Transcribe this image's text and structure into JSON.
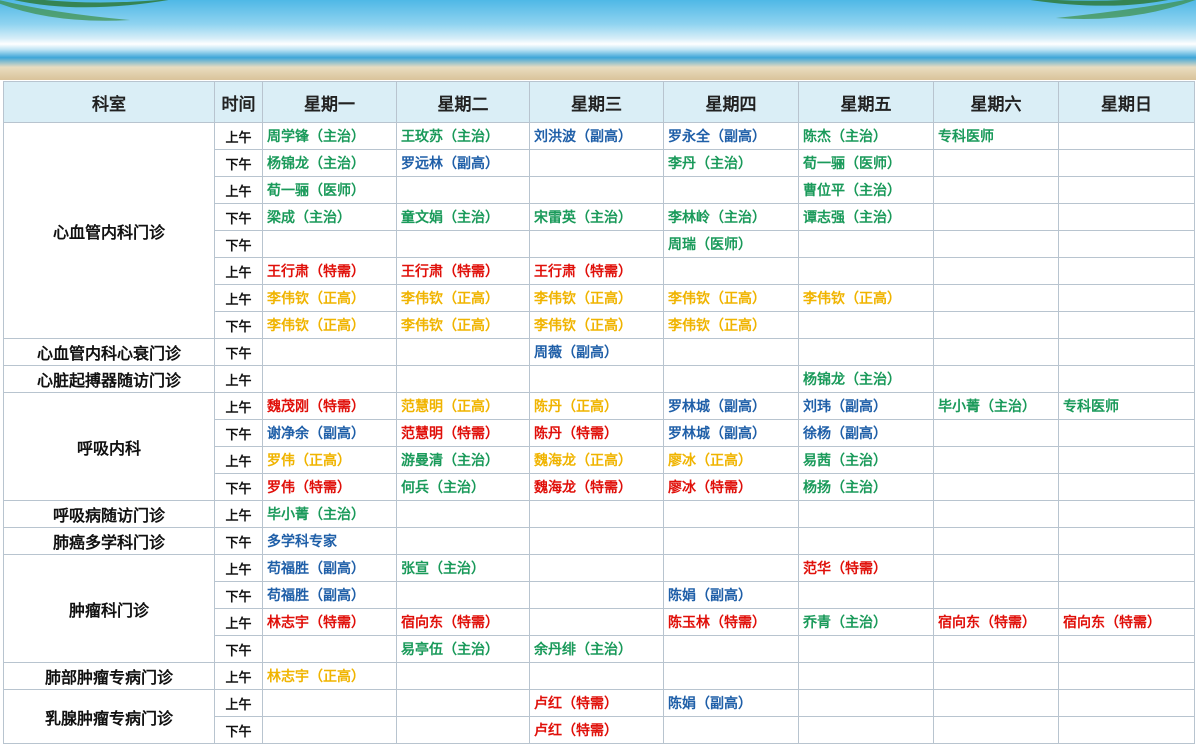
{
  "colors": {
    "blue": "#1f5fa8",
    "green": "#1a9a5a",
    "red": "#e0100a",
    "orange": "#f0b400",
    "header_bg": "#daeef6"
  },
  "headers": [
    "科室",
    "时间",
    "星期一",
    "星期二",
    "星期三",
    "星期四",
    "星期五",
    "星期六",
    "星期日"
  ],
  "rows": [
    {
      "dept": "心血管内科门诊",
      "span": 8,
      "time": "上午",
      "cells": [
        [
          "周学锋（主治）",
          "green"
        ],
        [
          "王玫苏（主治）",
          "green"
        ],
        [
          "刘洪波（副高）",
          "blue"
        ],
        [
          "罗永全（副高）",
          "blue"
        ],
        [
          "陈杰（主治）",
          "green"
        ],
        [
          "专科医师",
          "green"
        ],
        [
          "",
          ""
        ]
      ]
    },
    {
      "time": "下午",
      "cells": [
        [
          "杨锦龙（主治）",
          "green"
        ],
        [
          "罗远林（副高）",
          "blue"
        ],
        [
          "",
          ""
        ],
        [
          "李丹（主治）",
          "green"
        ],
        [
          "荀一骊（医师）",
          "green"
        ],
        [
          "",
          ""
        ],
        [
          "",
          ""
        ]
      ]
    },
    {
      "time": "上午",
      "cells": [
        [
          "荀一骊（医师）",
          "green"
        ],
        [
          "",
          ""
        ],
        [
          "",
          ""
        ],
        [
          "",
          ""
        ],
        [
          "曹位平（主治）",
          "green"
        ],
        [
          "",
          ""
        ],
        [
          "",
          ""
        ]
      ]
    },
    {
      "time": "下午",
      "cells": [
        [
          "梁成（主治）",
          "green"
        ],
        [
          "童文娟（主治）",
          "green"
        ],
        [
          "宋雷英（主治）",
          "green"
        ],
        [
          "李林岭（主治）",
          "green"
        ],
        [
          "谭志强（主治）",
          "green"
        ],
        [
          "",
          ""
        ],
        [
          "",
          ""
        ]
      ]
    },
    {
      "time": "下午",
      "cells": [
        [
          "",
          ""
        ],
        [
          "",
          ""
        ],
        [
          "",
          ""
        ],
        [
          "周瑞（医师）",
          "green"
        ],
        [
          "",
          ""
        ],
        [
          "",
          ""
        ],
        [
          "",
          ""
        ]
      ]
    },
    {
      "time": "上午",
      "cells": [
        [
          "王行肃（特需）",
          "red"
        ],
        [
          "王行肃（特需）",
          "red"
        ],
        [
          "王行肃（特需）",
          "red"
        ],
        [
          "",
          ""
        ],
        [
          "",
          ""
        ],
        [
          "",
          ""
        ],
        [
          "",
          ""
        ]
      ]
    },
    {
      "time": "上午",
      "cells": [
        [
          "李伟钦（正高）",
          "orange"
        ],
        [
          "李伟钦（正高）",
          "orange"
        ],
        [
          "李伟钦（正高）",
          "orange"
        ],
        [
          "李伟钦（正高）",
          "orange"
        ],
        [
          "李伟钦（正高）",
          "orange"
        ],
        [
          "",
          ""
        ],
        [
          "",
          ""
        ]
      ]
    },
    {
      "time": "下午",
      "cells": [
        [
          "李伟钦（正高）",
          "orange"
        ],
        [
          "李伟钦（正高）",
          "orange"
        ],
        [
          "李伟钦（正高）",
          "orange"
        ],
        [
          "李伟钦（正高）",
          "orange"
        ],
        [
          "",
          ""
        ],
        [
          "",
          ""
        ],
        [
          "",
          ""
        ]
      ]
    },
    {
      "dept": "心血管内科心衰门诊",
      "span": 1,
      "time": "下午",
      "cells": [
        [
          "",
          ""
        ],
        [
          "",
          ""
        ],
        [
          "周薇（副高）",
          "blue"
        ],
        [
          "",
          ""
        ],
        [
          "",
          ""
        ],
        [
          "",
          ""
        ],
        [
          "",
          ""
        ]
      ]
    },
    {
      "dept": "心脏起搏器随访门诊",
      "span": 1,
      "time": "上午",
      "cells": [
        [
          "",
          ""
        ],
        [
          "",
          ""
        ],
        [
          "",
          ""
        ],
        [
          "",
          ""
        ],
        [
          "杨锦龙（主治）",
          "green"
        ],
        [
          "",
          ""
        ],
        [
          "",
          ""
        ]
      ]
    },
    {
      "dept": "呼吸内科",
      "span": 4,
      "time": "上午",
      "cells": [
        [
          "魏茂刚（特需）",
          "red"
        ],
        [
          "范慧明（正高）",
          "orange"
        ],
        [
          "陈丹（正高）",
          "orange"
        ],
        [
          "罗林城（副高）",
          "blue"
        ],
        [
          "刘玮（副高）",
          "blue"
        ],
        [
          "毕小菁（主治）",
          "green"
        ],
        [
          "专科医师",
          "green"
        ]
      ]
    },
    {
      "time": "下午",
      "cells": [
        [
          "谢净余（副高）",
          "blue"
        ],
        [
          "范慧明（特需）",
          "red"
        ],
        [
          "陈丹（特需）",
          "red"
        ],
        [
          "罗林城（副高）",
          "blue"
        ],
        [
          "徐杨（副高）",
          "blue"
        ],
        [
          "",
          ""
        ],
        [
          "",
          ""
        ]
      ]
    },
    {
      "time": "上午",
      "cells": [
        [
          "罗伟（正高）",
          "orange"
        ],
        [
          "游曼清（主治）",
          "green"
        ],
        [
          "魏海龙（正高）",
          "orange"
        ],
        [
          "廖冰（正高）",
          "orange"
        ],
        [
          "易茜（主治）",
          "green"
        ],
        [
          "",
          ""
        ],
        [
          "",
          ""
        ]
      ]
    },
    {
      "time": "下午",
      "cells": [
        [
          "罗伟（特需）",
          "red"
        ],
        [
          "何兵（主治）",
          "green"
        ],
        [
          "魏海龙（特需）",
          "red"
        ],
        [
          "廖冰（特需）",
          "red"
        ],
        [
          "杨扬（主治）",
          "green"
        ],
        [
          "",
          ""
        ],
        [
          "",
          ""
        ]
      ]
    },
    {
      "dept": "呼吸病随访门诊",
      "span": 1,
      "time": "上午",
      "cells": [
        [
          "毕小菁（主治）",
          "green"
        ],
        [
          "",
          ""
        ],
        [
          "",
          ""
        ],
        [
          "",
          ""
        ],
        [
          "",
          ""
        ],
        [
          "",
          ""
        ],
        [
          "",
          ""
        ]
      ]
    },
    {
      "dept": "肺癌多学科门诊",
      "span": 1,
      "time": "下午",
      "cells": [
        [
          "多学科专家",
          "blue"
        ],
        [
          "",
          ""
        ],
        [
          "",
          ""
        ],
        [
          "",
          ""
        ],
        [
          "",
          ""
        ],
        [
          "",
          ""
        ],
        [
          "",
          ""
        ]
      ]
    },
    {
      "dept": "肿瘤科门诊",
      "span": 4,
      "time": "上午",
      "cells": [
        [
          "苟福胜（副高）",
          "blue"
        ],
        [
          "张宣（主治）",
          "green"
        ],
        [
          "",
          ""
        ],
        [
          "",
          ""
        ],
        [
          "范华（特需）",
          "red"
        ],
        [
          "",
          ""
        ],
        [
          "",
          ""
        ]
      ]
    },
    {
      "time": "下午",
      "cells": [
        [
          "苟福胜（副高）",
          "blue"
        ],
        [
          "",
          ""
        ],
        [
          "",
          ""
        ],
        [
          "陈娟（副高）",
          "blue"
        ],
        [
          "",
          ""
        ],
        [
          "",
          ""
        ],
        [
          "",
          ""
        ]
      ]
    },
    {
      "time": "上午",
      "cells": [
        [
          "林志宇（特需）",
          "red"
        ],
        [
          "宿向东（特需）",
          "red"
        ],
        [
          "",
          ""
        ],
        [
          "陈玉林（特需）",
          "red"
        ],
        [
          "乔青（主治）",
          "green"
        ],
        [
          "宿向东（特需）",
          "red"
        ],
        [
          "宿向东（特需）",
          "red"
        ]
      ]
    },
    {
      "time": "下午",
      "cells": [
        [
          "",
          ""
        ],
        [
          "易亭伍（主治）",
          "green"
        ],
        [
          "余丹绯（主治）",
          "green"
        ],
        [
          "",
          ""
        ],
        [
          "",
          ""
        ],
        [
          "",
          ""
        ],
        [
          "",
          ""
        ]
      ]
    },
    {
      "dept": "肺部肿瘤专病门诊",
      "span": 1,
      "time": "上午",
      "cells": [
        [
          "林志宇（正高）",
          "orange"
        ],
        [
          "",
          ""
        ],
        [
          "",
          ""
        ],
        [
          "",
          ""
        ],
        [
          "",
          ""
        ],
        [
          "",
          ""
        ],
        [
          "",
          ""
        ]
      ]
    },
    {
      "dept": "乳腺肿瘤专病门诊",
      "span": 2,
      "time": "上午",
      "cells": [
        [
          "",
          ""
        ],
        [
          "",
          ""
        ],
        [
          "卢红（特需）",
          "red"
        ],
        [
          "陈娟（副高）",
          "blue"
        ],
        [
          "",
          ""
        ],
        [
          "",
          ""
        ],
        [
          "",
          ""
        ]
      ]
    },
    {
      "time": "下午",
      "cells": [
        [
          "",
          ""
        ],
        [
          "",
          ""
        ],
        [
          "卢红（特需）",
          "red"
        ],
        [
          "",
          ""
        ],
        [
          "",
          ""
        ],
        [
          "",
          ""
        ],
        [
          "",
          ""
        ]
      ]
    }
  ]
}
